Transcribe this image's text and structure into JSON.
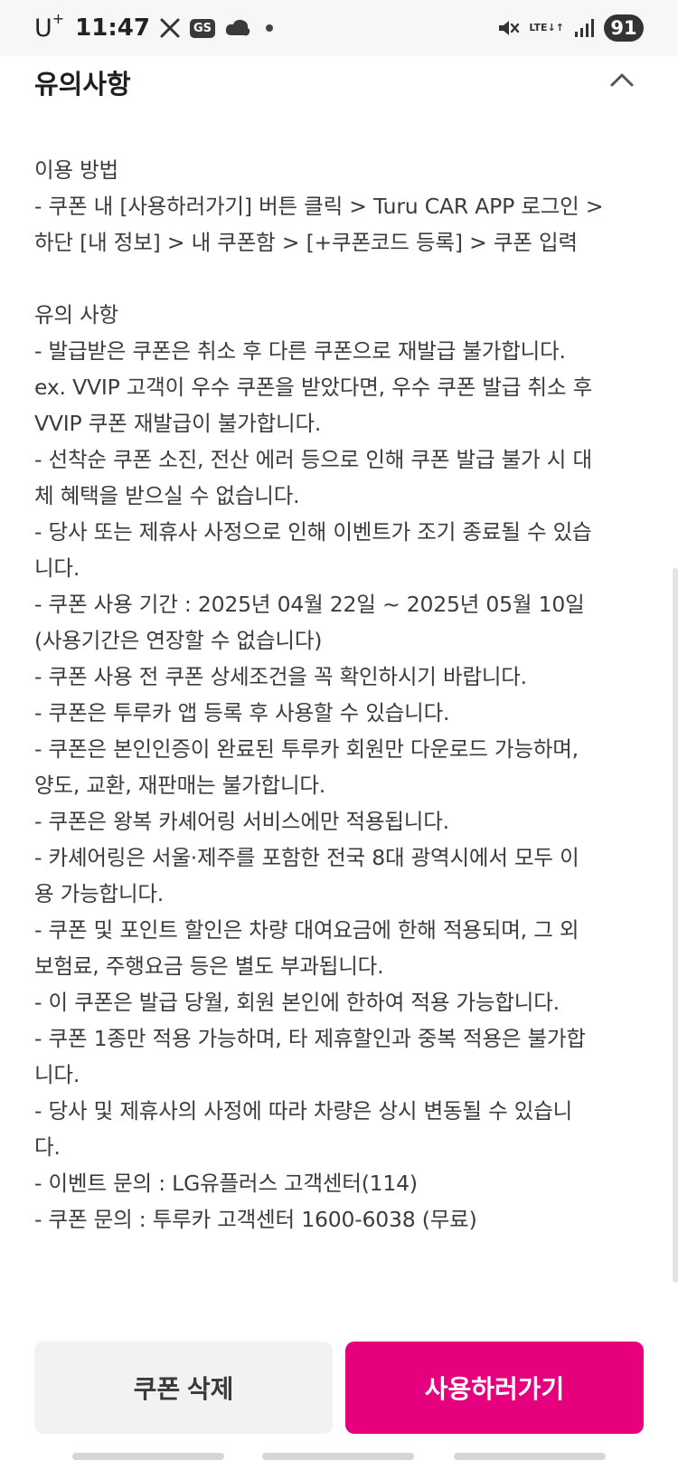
{
  "status_bar": {
    "carrier": "U",
    "carrier_sup": "+",
    "time": "11:47",
    "gs_badge": "GS",
    "network": "LTE",
    "battery": "91",
    "icons": [
      "x-icon",
      "gs-icon",
      "cloud-icon",
      "dot-icon",
      "mute-icon",
      "lte-icon",
      "signal-icon",
      "battery-icon"
    ]
  },
  "header": {
    "title": "유의사항",
    "collapse_icon": "chevron-up-icon"
  },
  "content": {
    "usage_lines": [
      "이용 방법",
      "- 쿠폰 내 [사용하러가기] 버튼 클릭 > Turu CAR APP 로그인 >",
      "하단 [내 정보] > 내 쿠폰함 > [+쿠폰코드 등록] > 쿠폰 입력"
    ],
    "notice_lines": [
      "유의 사항",
      "- 발급받은 쿠폰은 취소 후 다른 쿠폰으로 재발급 불가합니다.",
      "ex. VVIP 고객이 우수 쿠폰을 받았다면, 우수 쿠폰 발급 취소 후",
      "VVIP 쿠폰 재발급이 불가합니다.",
      "- 선착순 쿠폰 소진, 전산 에러 등으로 인해 쿠폰 발급 불가 시 대",
      "체 혜택을 받으실 수 없습니다.",
      "- 당사 또는 제휴사 사정으로 인해 이벤트가 조기 종료될 수 있습",
      "니다.",
      "- 쿠폰 사용 기간 : 2025년 04월 22일 ~ 2025년 05월 10일",
      "(사용기간은 연장할 수 없습니다)",
      "- 쿠폰 사용 전 쿠폰 상세조건을 꼭 확인하시기 바랍니다.",
      "- 쿠폰은 투루카 앱 등록 후 사용할 수 있습니다.",
      "- 쿠폰은 본인인증이 완료된 투루카 회원만 다운로드 가능하며,",
      "양도, 교환, 재판매는 불가합니다.",
      "- 쿠폰은 왕복 카셰어링 서비스에만 적용됩니다.",
      "- 카셰어링은 서울·제주를 포함한 전국 8대 광역시에서 모두 이",
      "용 가능합니다.",
      "- 쿠폰 및 포인트 할인은 차량 대여요금에 한해 적용되며, 그 외",
      "보험료, 주행요금 등은 별도 부과됩니다.",
      "- 이 쿠폰은 발급 당월, 회원 본인에 한하여 적용 가능합니다.",
      "- 쿠폰 1종만 적용 가능하며, 타 제휴할인과 중복 적용은 불가합",
      "니다.",
      "- 당사 및 제휴사의 사정에 따라 차량은 상시 변동될 수 있습니",
      "다.",
      "- 이벤트 문의 : LG유플러스 고객센터(114)",
      "- 쿠폰 문의 : 투루카 고객센터 1600-6038 (무료)"
    ]
  },
  "buttons": {
    "delete_label": "쿠폰 삭제",
    "use_label": "사용하러가기",
    "use_color": "#e6007e",
    "delete_bg": "#f1f2f4"
  }
}
